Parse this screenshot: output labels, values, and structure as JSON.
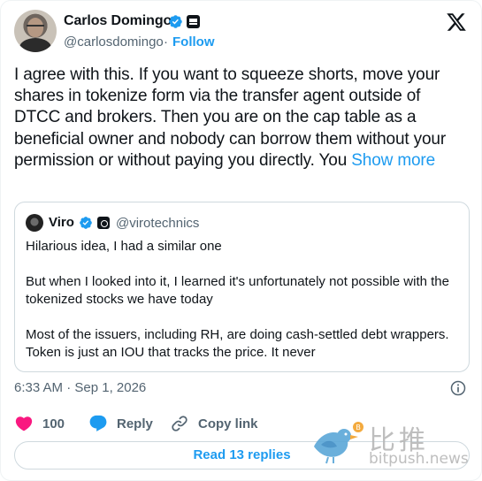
{
  "author": {
    "name": "Carlos Domingo",
    "handle": "@carlosdomingo",
    "separator": "·",
    "follow_label": "Follow"
  },
  "tweet": {
    "text": "I agree with this. If you want to squeeze shorts, move your shares in tokenize form via the transfer agent outside of DTCC and brokers. Then you are on the cap table as a beneficial owner and nobody can borrow them without your permission or without paying you directly. You ",
    "show_more_label": "Show more"
  },
  "quote": {
    "name": "Viro",
    "handle": "@virotechnics",
    "lines": [
      "Hilarious idea, I had a similar one",
      "",
      "But when I looked into it, I learned it's unfortunately not possible with the tokenized stocks we have today",
      "",
      "Most of the issuers, including RH, are doing cash-settled debt wrappers. Token is just an IOU that tracks the price. It never"
    ]
  },
  "timestamp": "6:33 AM · Sep 1, 2026",
  "actions": {
    "like_count": "100",
    "reply_label": "Reply",
    "copy_label": "Copy link"
  },
  "read_replies_label": "Read 13 replies",
  "watermark": {
    "cn": "比推",
    "en": "bitpush.news"
  },
  "colors": {
    "accent": "#1d9bf0",
    "like": "#f91880",
    "text": "#0f1419",
    "muted": "#536471",
    "border": "#cfd9de"
  },
  "icons": [
    "verified-badge-icon",
    "affiliate-badge-icon",
    "x-logo-icon",
    "info-icon",
    "heart-icon",
    "reply-bubble-icon",
    "link-icon"
  ]
}
